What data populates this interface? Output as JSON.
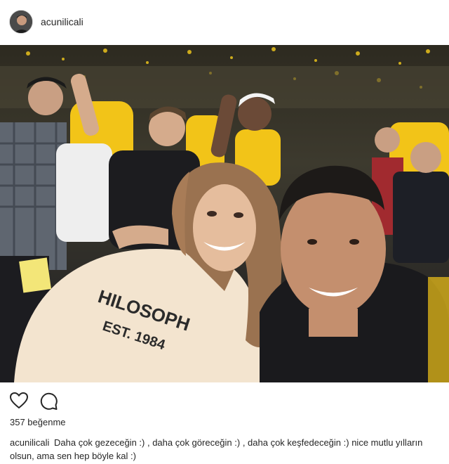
{
  "post": {
    "username": "acunilicali",
    "likes_text": "357 beğenme",
    "caption_user": "acunilicali",
    "caption_text": "Daha çok gezeceğin :) , daha çok göreceğin :) , daha çok keşfedeceğin :) nice mutlu yılların olsun, ama sen hep böyle kal :)"
  },
  "icons": {
    "like": "heart-outline-icon",
    "comment": "speech-bubble-icon"
  },
  "colors": {
    "text": "#262626",
    "crowd_yellow": "#f2c418",
    "sweater": "#f3e4cf"
  }
}
